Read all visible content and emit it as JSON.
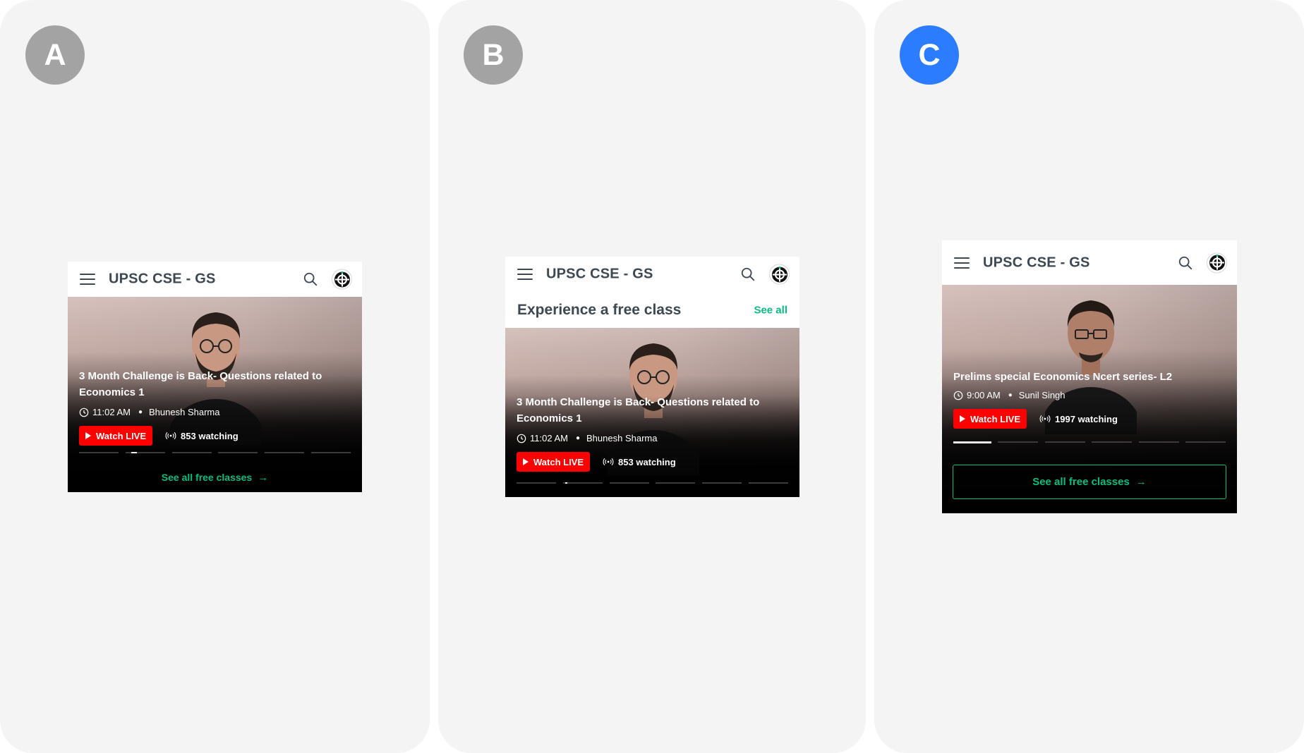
{
  "panels": {
    "a": {
      "badge": "A",
      "app_title": "UPSC CSE - GS",
      "class_title": "3 Month Challenge is Back- Questions related to Economics 1",
      "time": "11:02 AM",
      "educator": "Bhunesh Sharma",
      "watch_label": "Watch LIVE",
      "watching": "853 watching",
      "see_all_classes": "See all free classes"
    },
    "b": {
      "badge": "B",
      "app_title": "UPSC CSE - GS",
      "section_title": "Experience a free class",
      "see_all": "See all",
      "class_title": "3 Month Challenge is Back- Questions related to Economics 1",
      "time": "11:02 AM",
      "educator": "Bhunesh Sharma",
      "watch_label": "Watch LIVE",
      "watching": "853 watching"
    },
    "c": {
      "badge": "C",
      "app_title": "UPSC CSE - GS",
      "class_title": "Prelims special Economics Ncert series- L2",
      "time": "9:00 AM",
      "educator": "Sunil Singh",
      "watch_label": "Watch LIVE",
      "watching": "1997 watching",
      "see_all_classes": "See all free classes"
    }
  },
  "icons": {
    "menu": "hamburger-menu-icon",
    "search": "search-icon",
    "avatar": "unacademy-avatar-icon",
    "clock": "clock-icon",
    "play": "play-icon",
    "live": "live-broadcast-icon",
    "arrow": "arrow-right-icon"
  },
  "colors": {
    "badge_inactive": "#a3a3a3",
    "badge_active": "#2b7cff",
    "brand_green": "#08bd80",
    "live_red": "#ff0000",
    "text_dark": "#3c4852"
  },
  "selected_option": "C"
}
